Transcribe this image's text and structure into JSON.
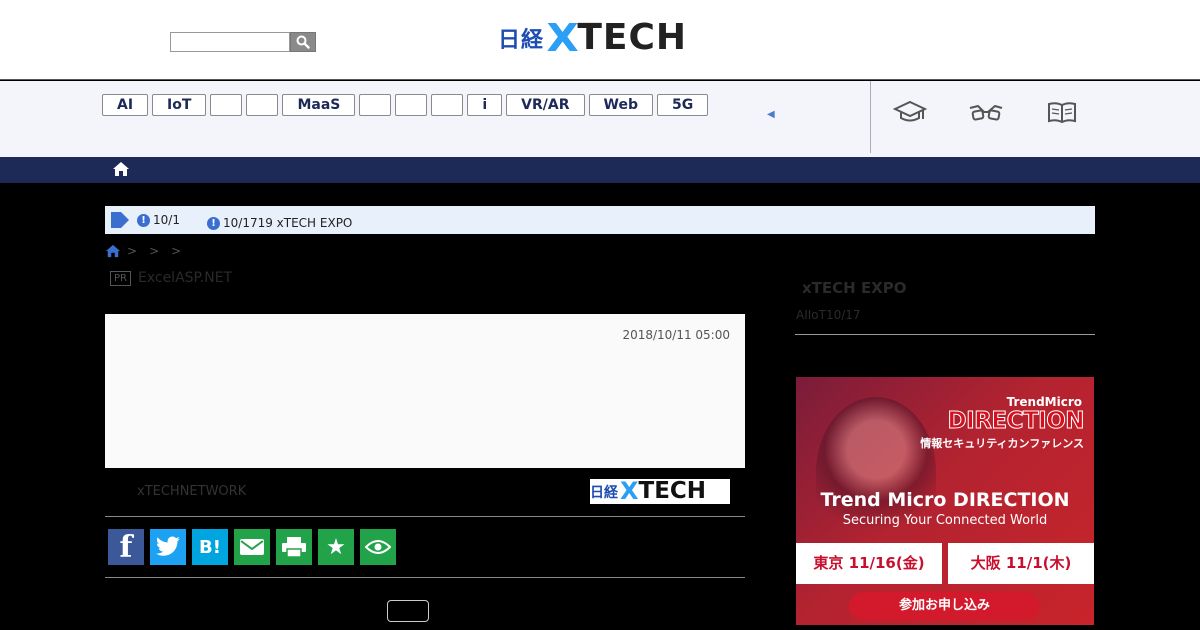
{
  "header": {
    "search": {
      "value": "",
      "placeholder": ""
    },
    "logo": {
      "jp": "日経",
      "x": "X",
      "tech": "TECH"
    }
  },
  "nav": {
    "tags": [
      "AI",
      "IoT",
      "",
      "",
      "MaaS",
      "",
      "",
      "",
      "i",
      "VR/AR",
      "Web",
      "5G"
    ],
    "arrow": "◀",
    "icons": [
      "graduation-cap-icon",
      "glasses-icon",
      "book-icon"
    ]
  },
  "notice": {
    "item1": "10/1",
    "item2": "10/1719 xTECH EXPO"
  },
  "breadcrumb": {
    "separators": [
      ">",
      ">",
      ">"
    ]
  },
  "pr": {
    "badge": "PR",
    "text": "ExcelASP.NET"
  },
  "article": {
    "date": "2018/10/11 05:00",
    "byline": "xTECHNETWORK",
    "byline_logo": {
      "jp": "日経",
      "x": "X",
      "tech": "TECH"
    }
  },
  "share": [
    "facebook",
    "twitter",
    "hatena",
    "mail",
    "print",
    "star",
    "eye"
  ],
  "sidebar": {
    "title": "xTECH EXPO",
    "subtitle": "AIIoT10/17"
  },
  "ad": {
    "brand": "TrendMicro",
    "direction": "DIRECTION",
    "jp": "情報セキュリティカンファレンス",
    "main": "Trend Micro DIRECTION",
    "sub": "Securing Your Connected World",
    "date_tokyo": "東京 11/16(金)",
    "date_osaka": "大阪 11/1(木)",
    "cta": "参加お申し込み"
  },
  "colors": {
    "navy": "#1d2a57",
    "accent_blue": "#2b9ff5",
    "logo_blue": "#1e4db2",
    "share_green": "#23a349"
  }
}
